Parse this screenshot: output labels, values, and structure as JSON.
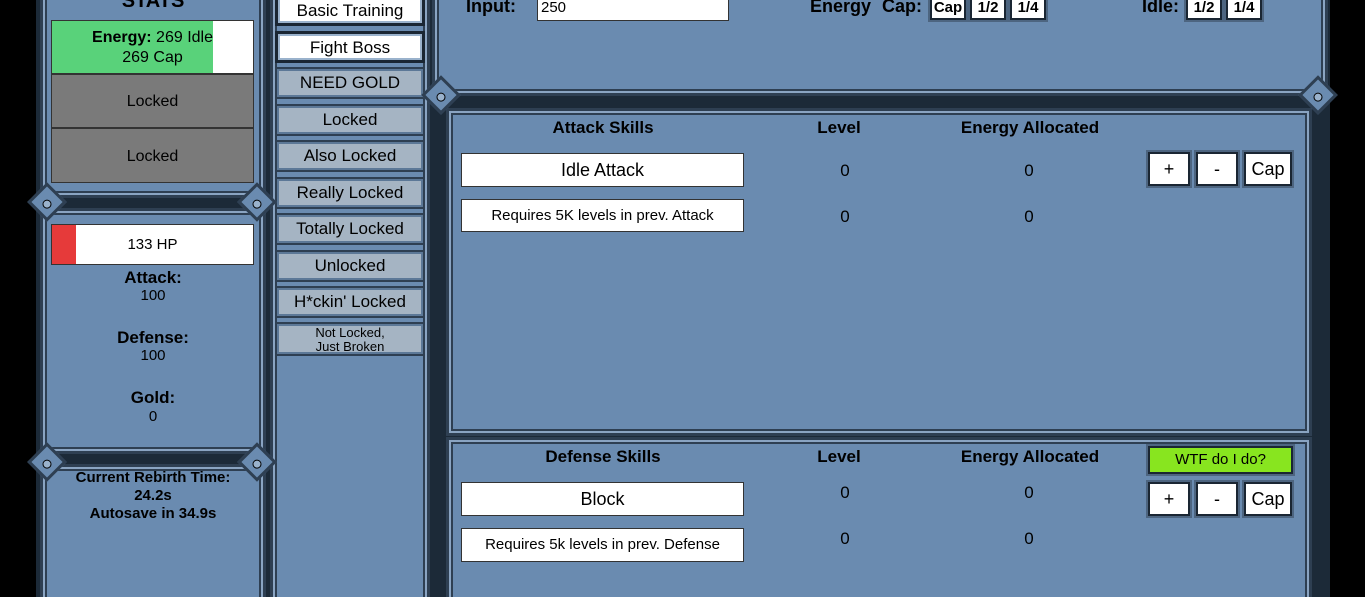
{
  "stats": {
    "title": "STATS",
    "energy_label": "Energy:",
    "energy_idle": "269 Idle",
    "energy_cap": "269 Cap",
    "energy_fill": 0.8,
    "locked_1": "Locked",
    "locked_2": "Locked",
    "hp_text": "133 HP",
    "hp_fill": 0.12,
    "attack_label": "Attack:",
    "attack_value": "100",
    "defense_label": "Defense:",
    "defense_value": "100",
    "gold_label": "Gold:",
    "gold_value": "0",
    "rebirth_label": "Current Rebirth Time:",
    "rebirth_value": "24.2s",
    "autosave": "Autosave in 34.9s"
  },
  "menu": {
    "items": [
      {
        "label": "Basic Training"
      },
      {
        "label": "Fight Boss"
      },
      {
        "label": "NEED GOLD"
      },
      {
        "label": "Locked"
      },
      {
        "label": "Also Locked"
      },
      {
        "label": "Really Locked"
      },
      {
        "label": "Totally Locked"
      },
      {
        "label": "Unlocked"
      },
      {
        "label": "H*ckin' Locked"
      },
      {
        "label_line1": "Not Locked,",
        "label_line2": "Just Broken"
      }
    ]
  },
  "topbar": {
    "input_label": "Input:",
    "input_value": "250",
    "energy_label": "Energy",
    "cap_label": "Cap:",
    "cap_buttons": [
      "Cap",
      "1/2",
      "1/4"
    ],
    "idle_label": "Idle:",
    "idle_buttons": [
      "1/2",
      "1/4"
    ]
  },
  "attack": {
    "header_skills": "Attack Skills",
    "header_level": "Level",
    "header_energy": "Energy Allocated",
    "rows": [
      {
        "name": "Idle Attack",
        "level": "0",
        "energy": "0"
      },
      {
        "name": "Requires 5K levels in prev. Attack",
        "level": "0",
        "energy": "0"
      }
    ],
    "btn_plus": "+",
    "btn_minus": "-",
    "btn_cap": "Cap"
  },
  "defense": {
    "header_skills": "Defense Skills",
    "header_level": "Level",
    "header_energy": "Energy Allocated",
    "help_button": "WTF do I do?",
    "help_color": "#88e51f",
    "rows": [
      {
        "name": "Block",
        "level": "0",
        "energy": "0"
      },
      {
        "name": "Requires 5k levels in prev. Defense",
        "level": "0",
        "energy": "0"
      }
    ],
    "btn_plus": "+",
    "btn_minus": "-",
    "btn_cap": "Cap"
  },
  "colors": {
    "panel": "#6a8bb0",
    "energy_bar": "#59d27a",
    "hp_bar": "#e63a3a"
  }
}
